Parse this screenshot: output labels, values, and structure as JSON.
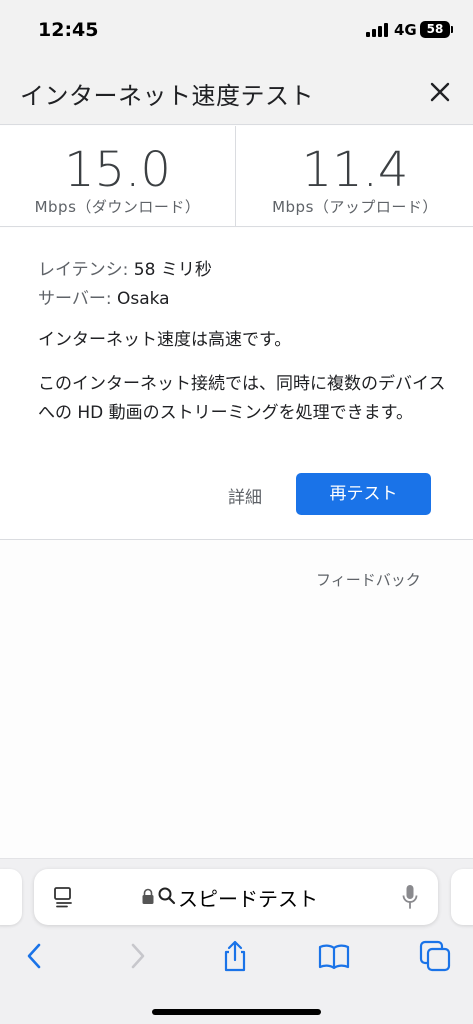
{
  "status_bar": {
    "time": "12:45",
    "network": "4G",
    "battery": "58"
  },
  "header": {
    "title": "インターネット速度テスト",
    "close_icon": "close-icon"
  },
  "metrics": {
    "download": {
      "value": "15.0",
      "unit": "Mbps（ダウンロード）"
    },
    "upload": {
      "value": "11.4",
      "unit": "Mbps（アップロード）"
    }
  },
  "info": {
    "latency_label": "レイテンシ:",
    "latency_value": "58 ミリ秒",
    "server_label": "サーバー:",
    "server_value": "Osaka",
    "speed_summary": "インターネット速度は高速です。",
    "description": "このインターネット接続では、同時に複数のデバイスへの HD 動画のストリーミングを処理できます。",
    "details_label": "詳細",
    "retest_label": "再テスト"
  },
  "feedback_label": "フィードバック",
  "safari": {
    "address_text": "スピードテスト",
    "accent_color": "#1a73e8",
    "icons": [
      "reader-icon",
      "lock-icon",
      "magnifier-icon",
      "mic-icon",
      "back-icon",
      "forward-icon",
      "share-icon",
      "bookmarks-icon",
      "tabs-icon"
    ]
  }
}
